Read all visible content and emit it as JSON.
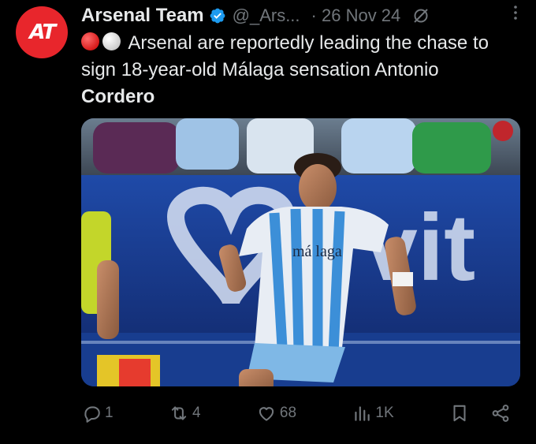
{
  "tweet": {
    "author_name": "Arsenal Team",
    "author_handle": "@_Ars...",
    "separator": "·",
    "date": "26 Nov 24",
    "avatar_text": "AT",
    "text_main": "Arsenal are reportedly leading the chase to sign 18-year-old Málaga sensation Antonio",
    "text_bold": "Cordero",
    "emojis": [
      "red-circle",
      "white-circle"
    ]
  },
  "media": {
    "jersey_sponsor": "má laga",
    "board_text": "vit"
  },
  "actions": {
    "replies": "1",
    "reposts": "4",
    "likes": "68",
    "views": "1K"
  },
  "colors": {
    "background": "#000000",
    "text": "#e7e9ea",
    "muted": "#71767b",
    "verified": "#1d9bf0",
    "avatar": "#e8262c"
  }
}
